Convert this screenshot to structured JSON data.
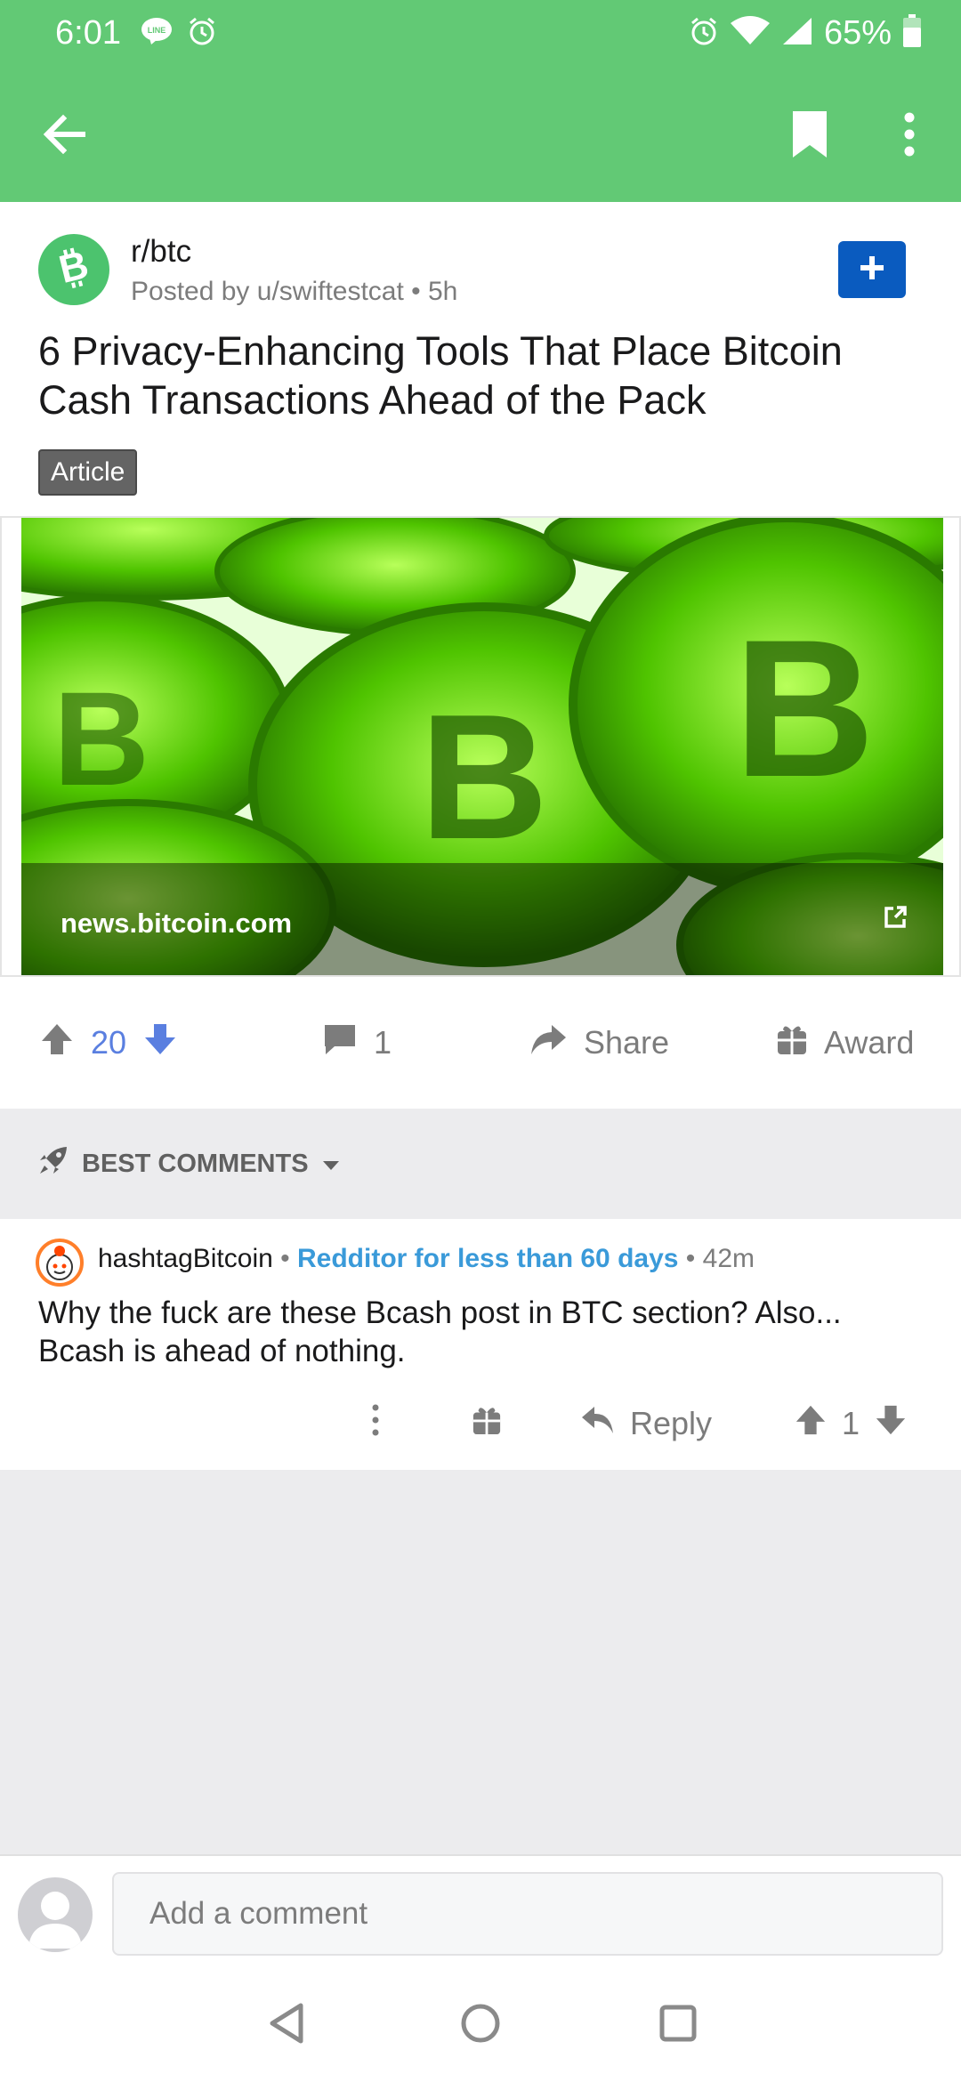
{
  "status_bar": {
    "time": "6:01",
    "battery": "65%",
    "icons": [
      "line-icon",
      "alarm-icon",
      "alarm-icon",
      "wifi-icon",
      "cell-signal-icon",
      "battery-icon"
    ]
  },
  "toolbar": {
    "icons": [
      "back-arrow-icon",
      "bookmark-icon",
      "more-vert-icon"
    ]
  },
  "post": {
    "subreddit": "r/btc",
    "posted_by": "Posted by u/swiftestcat • 5h",
    "title": "6 Privacy-Enhancing Tools That Place Bitcoin Cash Transactions Ahead of the Pack",
    "flair": "Article",
    "link_domain": "news.bitcoin.com",
    "image_alt": "bitcoin-coins-image"
  },
  "actions": {
    "score": "20",
    "comments": "1",
    "share": "Share",
    "award": "Award"
  },
  "comments": {
    "sort_label": "BEST COMMENTS",
    "items": [
      {
        "author": "hashtagBitcoin",
        "sep1": " • ",
        "flair": "Redditor for less than 60 days",
        "sep2": " • ",
        "age": "42m",
        "body": "Why the fuck are these Bcash post in BTC section? Also... Bcash is ahead of nothing.",
        "reply": "Reply",
        "score": "1"
      }
    ]
  },
  "composer": {
    "placeholder": "Add a comment"
  },
  "colors": {
    "toolbar": "#62c975",
    "join_button": "#0a5bbf",
    "vote_blue": "#5a7fe0",
    "flair_blue": "#3a9ad9"
  }
}
